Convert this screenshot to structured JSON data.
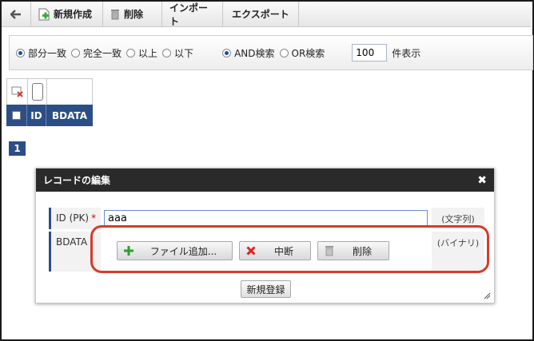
{
  "toolbar": {
    "back_icon": "back-arrow-icon",
    "new_label": "新規作成",
    "delete_label": "削除",
    "import_label": "インポート",
    "export_label": "エクスポート"
  },
  "filter": {
    "options": [
      "部分一致",
      "完全一致",
      "以上",
      "以下"
    ],
    "selected_match": "部分一致",
    "logic_options": [
      "AND検索",
      "OR検索"
    ],
    "selected_logic": "AND検索",
    "count_value": "100",
    "count_suffix": "件表示"
  },
  "grid": {
    "columns": [
      "ID",
      "BDATA"
    ]
  },
  "pager": {
    "current_page": "1"
  },
  "dialog": {
    "title": "レコードの編集",
    "close_icon": "close-icon",
    "fields": [
      {
        "label": "ID (PK)",
        "required_mark": "*",
        "value": "aaa",
        "type": "(文字列)"
      },
      {
        "label": "BDATA",
        "type": "(バイナリ)"
      }
    ],
    "buttons": {
      "add_file": "ファイル追加...",
      "stop": "中断",
      "delete": "削除"
    },
    "save_label": "新規登録"
  },
  "colors": {
    "header_blue": "#2c4e86",
    "dialog_title_bg": "#2a2a2a",
    "highlight_red": "#d93a2b"
  }
}
